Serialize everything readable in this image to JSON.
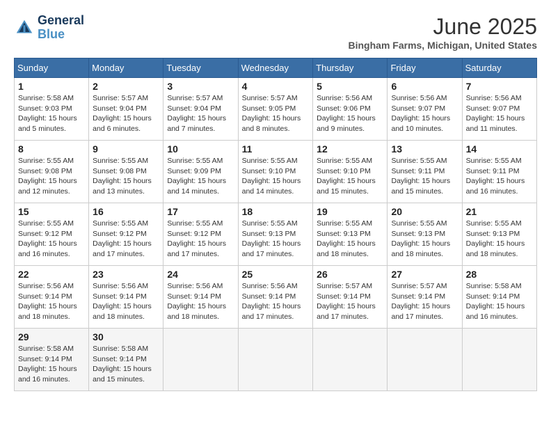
{
  "header": {
    "logo_line1": "General",
    "logo_line2": "Blue",
    "month_title": "June 2025",
    "location": "Bingham Farms, Michigan, United States"
  },
  "days_of_week": [
    "Sunday",
    "Monday",
    "Tuesday",
    "Wednesday",
    "Thursday",
    "Friday",
    "Saturday"
  ],
  "weeks": [
    [
      {
        "day": "1",
        "info": "Sunrise: 5:58 AM\nSunset: 9:03 PM\nDaylight: 15 hours\nand 5 minutes."
      },
      {
        "day": "2",
        "info": "Sunrise: 5:57 AM\nSunset: 9:04 PM\nDaylight: 15 hours\nand 6 minutes."
      },
      {
        "day": "3",
        "info": "Sunrise: 5:57 AM\nSunset: 9:04 PM\nDaylight: 15 hours\nand 7 minutes."
      },
      {
        "day": "4",
        "info": "Sunrise: 5:57 AM\nSunset: 9:05 PM\nDaylight: 15 hours\nand 8 minutes."
      },
      {
        "day": "5",
        "info": "Sunrise: 5:56 AM\nSunset: 9:06 PM\nDaylight: 15 hours\nand 9 minutes."
      },
      {
        "day": "6",
        "info": "Sunrise: 5:56 AM\nSunset: 9:07 PM\nDaylight: 15 hours\nand 10 minutes."
      },
      {
        "day": "7",
        "info": "Sunrise: 5:56 AM\nSunset: 9:07 PM\nDaylight: 15 hours\nand 11 minutes."
      }
    ],
    [
      {
        "day": "8",
        "info": "Sunrise: 5:55 AM\nSunset: 9:08 PM\nDaylight: 15 hours\nand 12 minutes."
      },
      {
        "day": "9",
        "info": "Sunrise: 5:55 AM\nSunset: 9:08 PM\nDaylight: 15 hours\nand 13 minutes."
      },
      {
        "day": "10",
        "info": "Sunrise: 5:55 AM\nSunset: 9:09 PM\nDaylight: 15 hours\nand 14 minutes."
      },
      {
        "day": "11",
        "info": "Sunrise: 5:55 AM\nSunset: 9:10 PM\nDaylight: 15 hours\nand 14 minutes."
      },
      {
        "day": "12",
        "info": "Sunrise: 5:55 AM\nSunset: 9:10 PM\nDaylight: 15 hours\nand 15 minutes."
      },
      {
        "day": "13",
        "info": "Sunrise: 5:55 AM\nSunset: 9:11 PM\nDaylight: 15 hours\nand 15 minutes."
      },
      {
        "day": "14",
        "info": "Sunrise: 5:55 AM\nSunset: 9:11 PM\nDaylight: 15 hours\nand 16 minutes."
      }
    ],
    [
      {
        "day": "15",
        "info": "Sunrise: 5:55 AM\nSunset: 9:12 PM\nDaylight: 15 hours\nand 16 minutes."
      },
      {
        "day": "16",
        "info": "Sunrise: 5:55 AM\nSunset: 9:12 PM\nDaylight: 15 hours\nand 17 minutes."
      },
      {
        "day": "17",
        "info": "Sunrise: 5:55 AM\nSunset: 9:12 PM\nDaylight: 15 hours\nand 17 minutes."
      },
      {
        "day": "18",
        "info": "Sunrise: 5:55 AM\nSunset: 9:13 PM\nDaylight: 15 hours\nand 17 minutes."
      },
      {
        "day": "19",
        "info": "Sunrise: 5:55 AM\nSunset: 9:13 PM\nDaylight: 15 hours\nand 18 minutes."
      },
      {
        "day": "20",
        "info": "Sunrise: 5:55 AM\nSunset: 9:13 PM\nDaylight: 15 hours\nand 18 minutes."
      },
      {
        "day": "21",
        "info": "Sunrise: 5:55 AM\nSunset: 9:13 PM\nDaylight: 15 hours\nand 18 minutes."
      }
    ],
    [
      {
        "day": "22",
        "info": "Sunrise: 5:56 AM\nSunset: 9:14 PM\nDaylight: 15 hours\nand 18 minutes."
      },
      {
        "day": "23",
        "info": "Sunrise: 5:56 AM\nSunset: 9:14 PM\nDaylight: 15 hours\nand 18 minutes."
      },
      {
        "day": "24",
        "info": "Sunrise: 5:56 AM\nSunset: 9:14 PM\nDaylight: 15 hours\nand 18 minutes."
      },
      {
        "day": "25",
        "info": "Sunrise: 5:56 AM\nSunset: 9:14 PM\nDaylight: 15 hours\nand 17 minutes."
      },
      {
        "day": "26",
        "info": "Sunrise: 5:57 AM\nSunset: 9:14 PM\nDaylight: 15 hours\nand 17 minutes."
      },
      {
        "day": "27",
        "info": "Sunrise: 5:57 AM\nSunset: 9:14 PM\nDaylight: 15 hours\nand 17 minutes."
      },
      {
        "day": "28",
        "info": "Sunrise: 5:58 AM\nSunset: 9:14 PM\nDaylight: 15 hours\nand 16 minutes."
      }
    ],
    [
      {
        "day": "29",
        "info": "Sunrise: 5:58 AM\nSunset: 9:14 PM\nDaylight: 15 hours\nand 16 minutes."
      },
      {
        "day": "30",
        "info": "Sunrise: 5:58 AM\nSunset: 9:14 PM\nDaylight: 15 hours\nand 15 minutes."
      },
      {
        "day": "",
        "info": ""
      },
      {
        "day": "",
        "info": ""
      },
      {
        "day": "",
        "info": ""
      },
      {
        "day": "",
        "info": ""
      },
      {
        "day": "",
        "info": ""
      }
    ]
  ]
}
